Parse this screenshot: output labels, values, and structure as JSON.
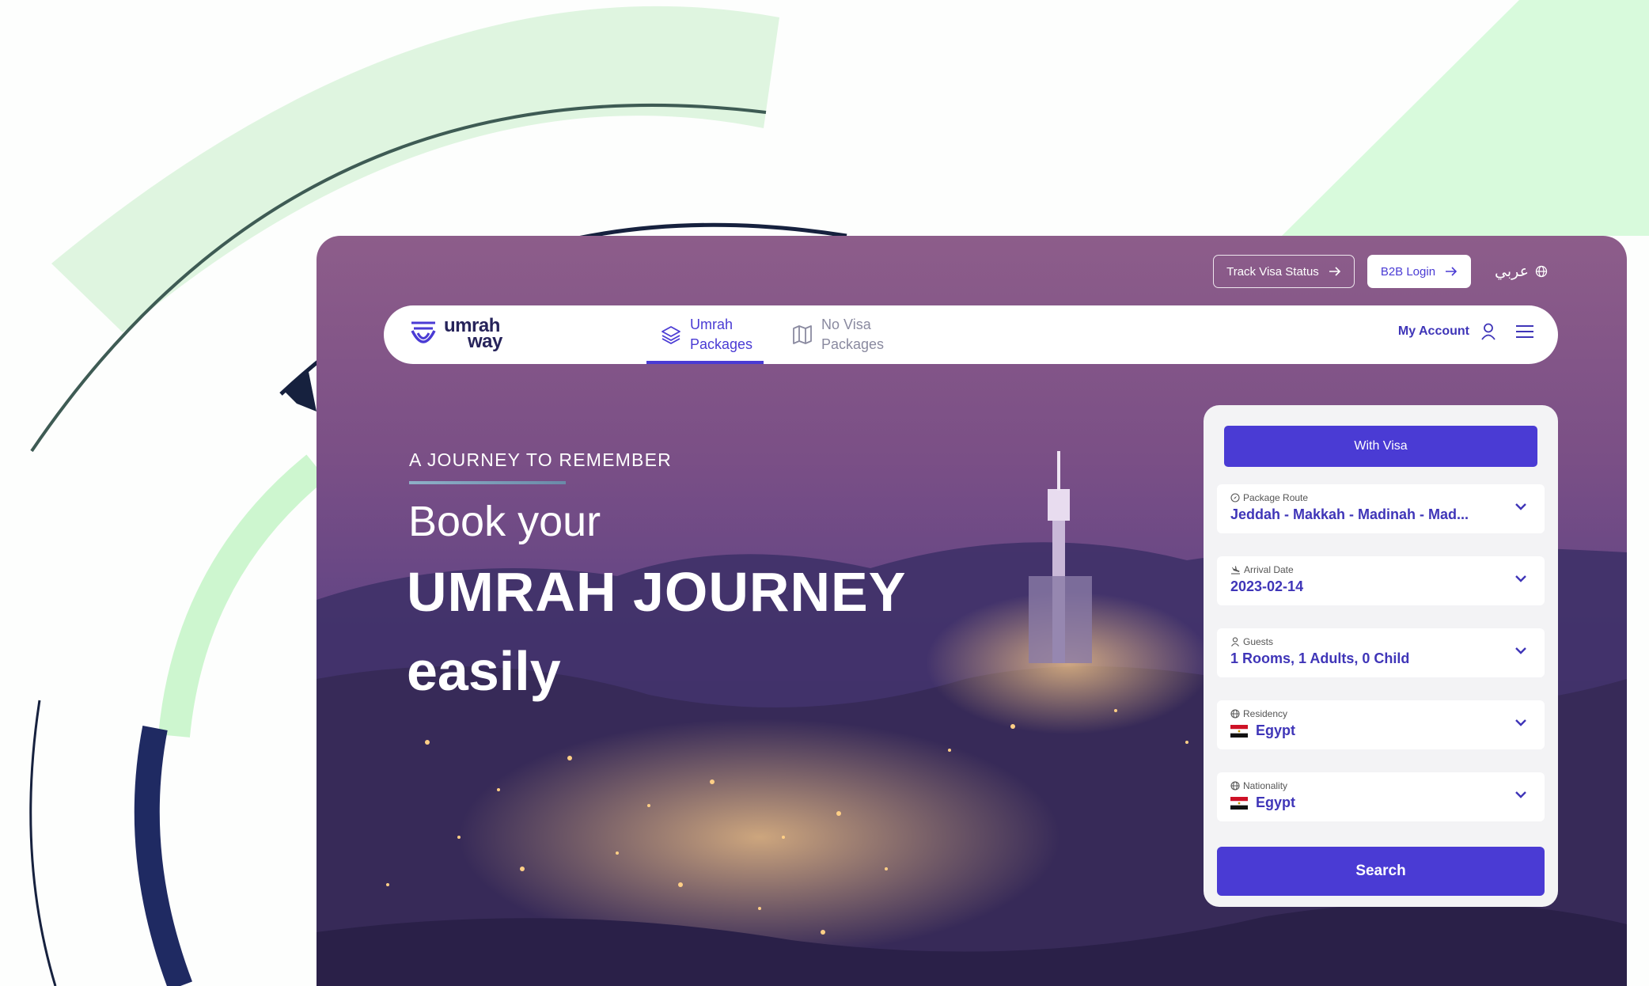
{
  "colors": {
    "accent": "#4a3bd4",
    "brand_dark": "#26235a",
    "mint": "#d6f5d8"
  },
  "top_bar": {
    "track_visa_label": "Track Visa Status",
    "b2b_login_label": "B2B Login",
    "language_label": "عربي"
  },
  "nav": {
    "logo_line1": "umrah",
    "logo_line2": "way",
    "tabs": [
      {
        "line1": "Umrah",
        "line2": "Packages",
        "icon": "layers-icon",
        "active": true
      },
      {
        "line1": "No Visa",
        "line2": "Packages",
        "icon": "map-icon",
        "active": false
      }
    ],
    "account_label": "My Account"
  },
  "hero": {
    "kicker": "A JOURNEY TO REMEMBER",
    "line1": "Book your",
    "line2": "UMRAH JOURNEY",
    "line3": "easily"
  },
  "booking": {
    "type_button": "With Visa",
    "fields": [
      {
        "label": "Package Route",
        "value": "Jeddah - Makkah - Madinah - Mad..."
      },
      {
        "label": "Arrival Date",
        "value": "2023-02-14"
      },
      {
        "label": "Guests",
        "value": "1 Rooms, 1 Adults, 0 Child"
      },
      {
        "label": "Residency",
        "value": "Egypt"
      },
      {
        "label": "Nationality",
        "value": "Egypt"
      }
    ],
    "search_label": "Search"
  }
}
